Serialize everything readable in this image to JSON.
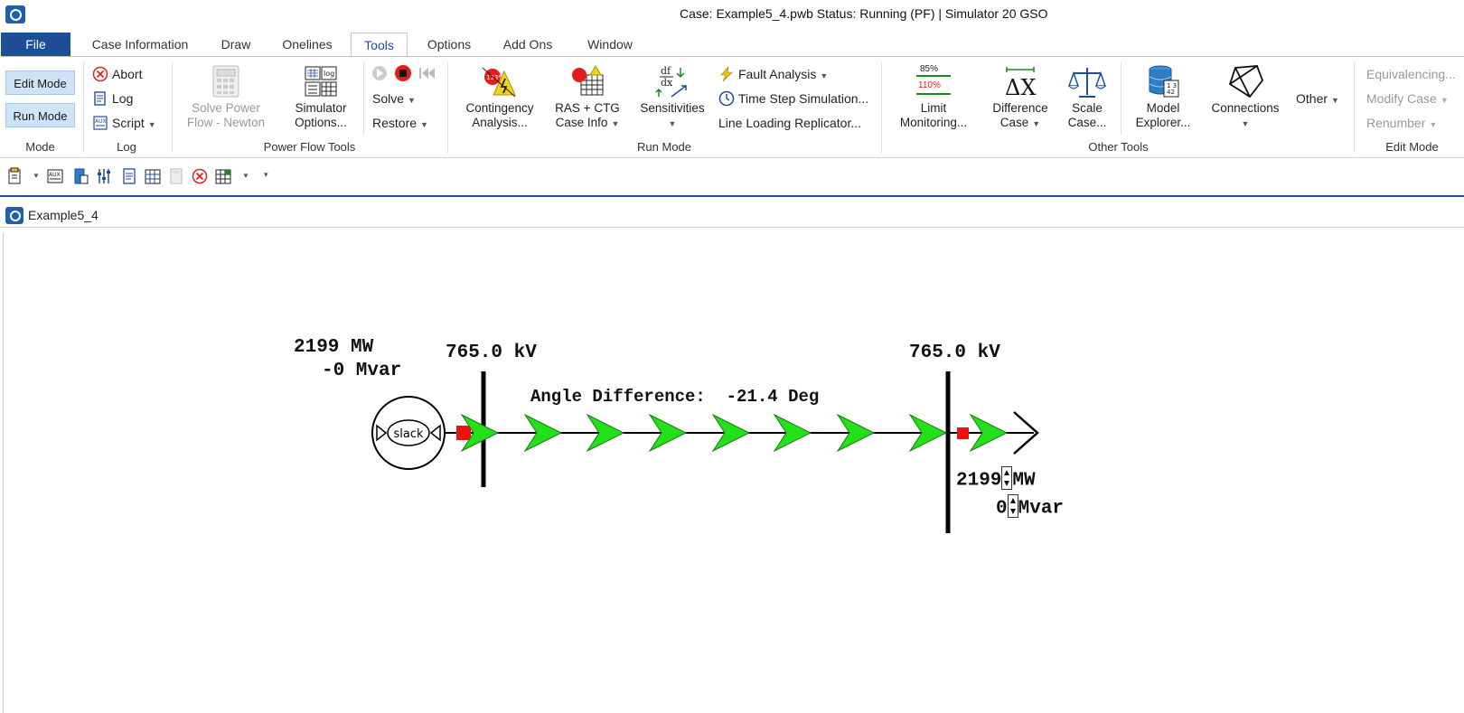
{
  "window": {
    "title": "Case: Example5_4.pwb  Status: Running (PF) | Simulator 20 GSO"
  },
  "tabs": [
    {
      "label": "File"
    },
    {
      "label": "Case Information"
    },
    {
      "label": "Draw"
    },
    {
      "label": "Onelines"
    },
    {
      "label": "Tools"
    },
    {
      "label": "Options"
    },
    {
      "label": "Add Ons"
    },
    {
      "label": "Window"
    }
  ],
  "active_tab": "Tools",
  "ribbon": {
    "mode": {
      "edit_mode": "Edit Mode",
      "run_mode": "Run Mode",
      "label": "Mode"
    },
    "log": {
      "abort": "Abort",
      "log": "Log",
      "script": "Script",
      "label": "Log"
    },
    "power_flow_tools": {
      "solve_power_flow_line1": "Solve Power",
      "solve_power_flow_line2": "Flow - Newton",
      "simulator_options_line1": "Simulator",
      "simulator_options_line2": "Options...",
      "solve": "Solve",
      "restore": "Restore",
      "label": "Power Flow Tools"
    },
    "run_mode": {
      "contingency_line1": "Contingency",
      "contingency_line2": "Analysis...",
      "ras_line1": "RAS + CTG",
      "ras_line2": "Case Info",
      "sensitivities": "Sensitivities",
      "fault_analysis": "Fault Analysis",
      "time_step": "Time Step Simulation...",
      "line_loading": "Line Loading Replicator...",
      "label": "Run Mode"
    },
    "other_tools": {
      "limit_line1": "Limit",
      "limit_line2": "Monitoring...",
      "limit_pct_top": "85%",
      "limit_pct_bottom": "110%",
      "difference_line1": "Difference",
      "difference_line2": "Case",
      "scale_line1": "Scale",
      "scale_line2": "Case...",
      "model_line1": "Model",
      "model_line2": "Explorer...",
      "connections": "Connections",
      "other": "Other",
      "label": "Other Tools"
    },
    "edit_mode": {
      "equivalencing": "Equivalencing...",
      "modify_case": "Modify Case",
      "renumber": "Renumber",
      "label": "Edit Mode"
    }
  },
  "document": {
    "tab_title": "Example5_4"
  },
  "oneline": {
    "gen_mw": "2199 MW",
    "gen_mvar": "-0 Mvar",
    "bus1_kv": "765.0 kV",
    "bus2_kv": "765.0 kV",
    "angle_label": "Angle Difference:",
    "angle_value": "-21.4 Deg",
    "slack_label": "slack",
    "load_mw_value": "2199",
    "load_mw_unit": "MW",
    "load_mvar_value": "0",
    "load_mvar_unit": "Mvar"
  },
  "colors": {
    "file_tab": "#1f4e99",
    "flow_arrow": "#22e01a",
    "breaker": "#ee1111",
    "mode_button": "#cfe3f7"
  }
}
